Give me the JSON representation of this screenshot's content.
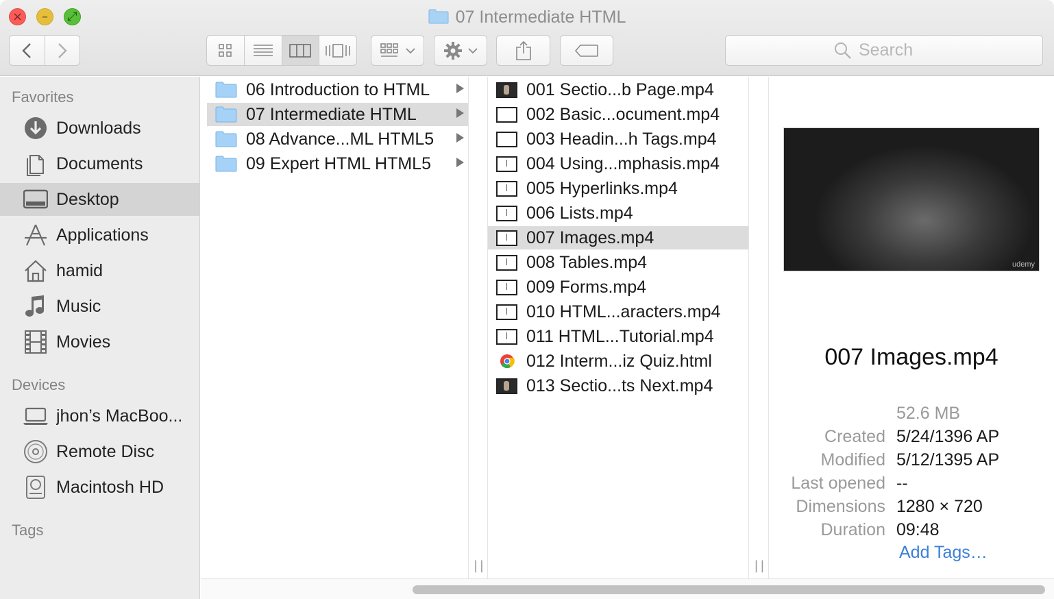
{
  "window": {
    "title": "07 Intermediate HTML",
    "buttons": {
      "close": "×",
      "minimize": "–",
      "zoom": "⤢"
    }
  },
  "toolbar": {
    "search_placeholder": "Search",
    "icons": [
      "chevron-left-icon",
      "chevron-right-icon",
      "icon-view-icon",
      "list-view-icon",
      "column-view-icon",
      "cover-flow-icon",
      "arrange-icon",
      "gear-icon",
      "share-icon",
      "tag-icon",
      "search-icon"
    ]
  },
  "sidebar": {
    "favorites_heading": "Favorites",
    "favorites": [
      {
        "label": "Downloads",
        "icon": "downloads-icon"
      },
      {
        "label": "Documents",
        "icon": "documents-icon"
      },
      {
        "label": "Desktop",
        "icon": "desktop-icon",
        "selected": true
      },
      {
        "label": "Applications",
        "icon": "applications-icon"
      },
      {
        "label": "hamid",
        "icon": "home-icon"
      },
      {
        "label": "Music",
        "icon": "music-icon"
      },
      {
        "label": "Movies",
        "icon": "movies-icon"
      }
    ],
    "devices_heading": "Devices",
    "devices": [
      {
        "label": "jhon’s MacBoo...",
        "icon": "laptop-icon"
      },
      {
        "label": "Remote Disc",
        "icon": "disc-icon"
      },
      {
        "label": "Macintosh HD",
        "icon": "hard-drive-icon"
      }
    ],
    "tags_heading": "Tags"
  },
  "column1": {
    "items": [
      {
        "label": "06 Introduction to HTML"
      },
      {
        "label": "07 Intermediate HTML",
        "selected": true
      },
      {
        "label": "08 Advance...ML  HTML5"
      },
      {
        "label": "09 Expert HTML  HTML5"
      }
    ]
  },
  "column2": {
    "items": [
      {
        "label": "001 Sectio...b Page.mp4",
        "thumb": "dark"
      },
      {
        "label": "002 Basic...ocument.mp4",
        "thumb": "white"
      },
      {
        "label": "003 Headin...h Tags.mp4",
        "thumb": "white"
      },
      {
        "label": "004 Using...mphasis.mp4",
        "thumb": "slide"
      },
      {
        "label": "005 Hyperlinks.mp4",
        "thumb": "slide"
      },
      {
        "label": "006 Lists.mp4",
        "thumb": "slide"
      },
      {
        "label": "007 Images.mp4",
        "thumb": "slide",
        "selected": true
      },
      {
        "label": "008 Tables.mp4",
        "thumb": "slide"
      },
      {
        "label": "009 Forms.mp4",
        "thumb": "slide"
      },
      {
        "label": "010 HTML...aracters.mp4",
        "thumb": "slide"
      },
      {
        "label": "011 HTML...Tutorial.mp4",
        "thumb": "slide"
      },
      {
        "label": "012 Interm...iz Quiz.html",
        "thumb": "chrome"
      },
      {
        "label": "013 Sectio...ts Next.mp4",
        "thumb": "dark"
      }
    ]
  },
  "preview": {
    "watermark": "udemy",
    "filename": "007 Images.mp4",
    "size": "52.6 MB",
    "created_label": "Created",
    "created": "5/24/1396 AP",
    "modified_label": "Modified",
    "modified": "5/12/1395 AP",
    "last_opened_label": "Last opened",
    "last_opened": "--",
    "dimensions_label": "Dimensions",
    "dimensions": "1280 × 720",
    "duration_label": "Duration",
    "duration": "09:48",
    "add_tags": "Add Tags…"
  },
  "column_grip": "||"
}
